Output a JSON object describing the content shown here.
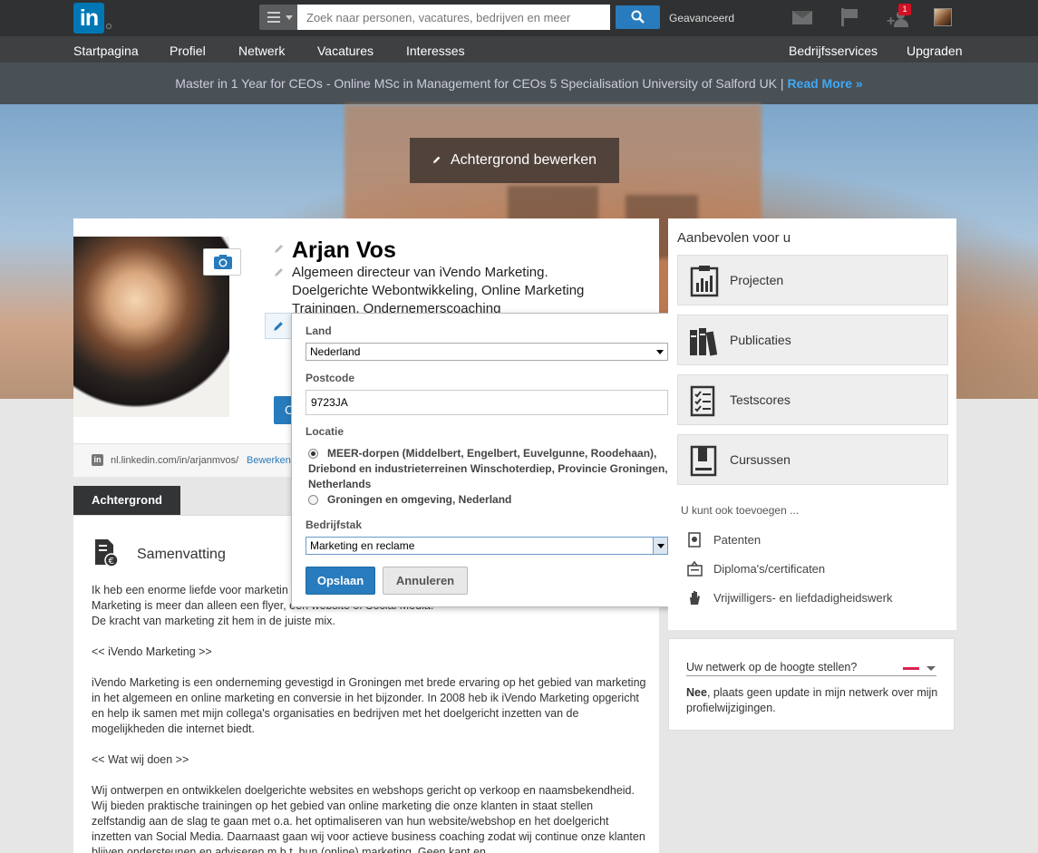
{
  "topbar": {
    "logo_text": "in",
    "search_placeholder": "Zoek naar personen, vacatures, bedrijven en meer",
    "advanced_label": "Geavanceerd",
    "notification_count": "1"
  },
  "nav": {
    "items": [
      "Startpagina",
      "Profiel",
      "Netwerk",
      "Vacatures",
      "Interesses"
    ],
    "right_items": [
      "Bedrijfsservices",
      "Upgraden"
    ]
  },
  "ad": {
    "text": "Master in 1 Year for CEOs - Online MSc in Management for CEOs 5 Specialisation University of Salford UK | ",
    "link": "Read More »"
  },
  "hero": {
    "edit_background_label": "Achtergrond bewerken"
  },
  "profile": {
    "name": "Arjan Vos",
    "headline": "Algemeen directeur van iVendo Marketing. Doelgerichte Webontwikkeling, Online Marketing Trainingen, Ondernemerscoaching",
    "contact_btn_char": "C",
    "url": "nl.linkedin.com/in/arjanmvos/",
    "url_edit": "Bewerken"
  },
  "location_form": {
    "country_label": "Land",
    "country_value": "Nederland",
    "postcode_label": "Postcode",
    "postcode_value": "9723JA",
    "location_label": "Locatie",
    "location_options": [
      "MEER-dorpen (Middelbert, Engelbert, Euvelgunne, Roodehaan), Driebond en industrieterreinen Winschoterdiep, Provincie Groningen, Netherlands",
      "Groningen en omgeving, Nederland"
    ],
    "location_selected_index": 0,
    "industry_label": "Bedrijfstak",
    "industry_value": "Marketing en reclame",
    "save_label": "Opslaan",
    "cancel_label": "Annuleren"
  },
  "background": {
    "tab_label": "Achtergrond",
    "summary_title": "Samenvatting",
    "summary_text": "Ik heb een enorme liefde voor marketin\nMarketing is meer dan alleen een flyer, een website of Social Media.\nDe kracht van marketing zit hem in de juiste mix.\n\n<< iVendo Marketing >>\n\niVendo Marketing is een onderneming gevestigd in Groningen met brede ervaring op het gebied van marketing in het algemeen en online marketing en conversie in het bijzonder. In 2008 heb ik iVendo Marketing opgericht en help ik samen met mijn collega's organisaties en bedrijven met het doelgericht inzetten van de mogelijkheden die internet biedt.\n\n<< Wat wij doen >>\n\nWij ontwerpen en ontwikkelen doelgerichte websites en webshops gericht op verkoop en naamsbekendheid. Wij bieden praktische trainingen op het gebied van online marketing die onze klanten in staat stellen zelfstandig aan de slag te gaan met o.a. het optimaliseren van hun website/webshop en het doelgericht inzetten van Social Media. Daarnaast gaan wij voor actieve business coaching zodat wij continue onze klanten blijven ondersteunen en adviseren m.b.t. hun (online) marketing. Geen kant en"
  },
  "recommended": {
    "title": "Aanbevolen voor u",
    "items": [
      "Projecten",
      "Publicaties",
      "Testscores",
      "Cursussen"
    ],
    "add_more_label": "U kunt ook toevoegen ...",
    "add_items": [
      "Patenten",
      "Diploma's/certificaten",
      "Vrijwilligers- en liefdadigheidswerk"
    ]
  },
  "network": {
    "title": "Uw netwerk op de hoogte stellen?",
    "answer": "Nee",
    "description": ", plaats geen update in mijn netwerk over mijn profielwijzigingen."
  },
  "colors": {
    "linkedin_blue": "#0077b5",
    "button_blue": "#287bbc",
    "topbar": "#2f3132",
    "navbar": "#3e4042",
    "badge_red": "#d11124"
  }
}
